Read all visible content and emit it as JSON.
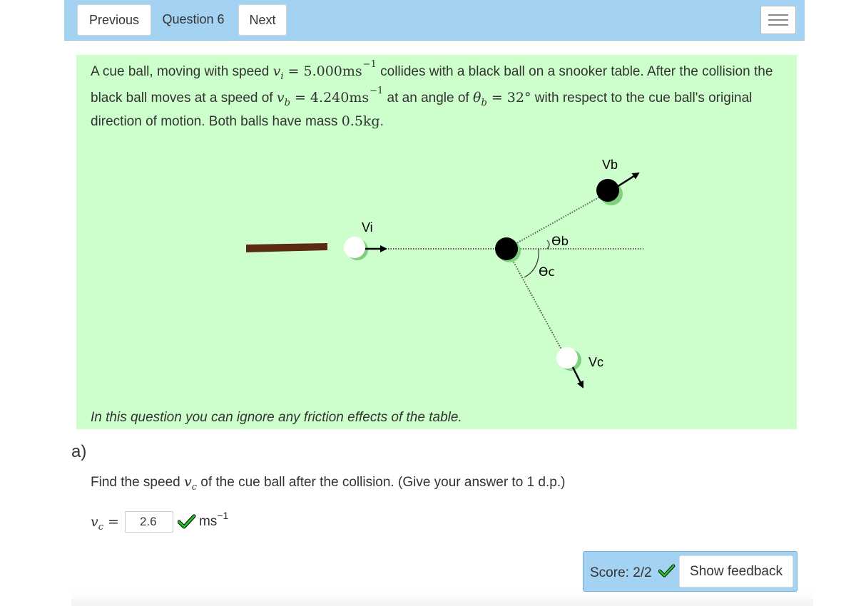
{
  "nav": {
    "previous_label": "Previous",
    "question_label": "Question 6",
    "next_label": "Next"
  },
  "statement": {
    "line1_a": "A cue ball, moving with speed ",
    "vi_symbol": "v",
    "vi_sub": "i",
    "eq1": " = 5.000ms",
    "exp1": "−1",
    "line1_b": " collides with a black ball on a snooker table. After the collision the",
    "line2_a": "black ball moves at a speed of ",
    "vb_symbol": "v",
    "vb_sub": "b",
    "eq2": " = 4.240ms",
    "exp2": "−1",
    "line2_b": " at an angle of ",
    "theta_symbol": "θ",
    "theta_sub": "b",
    "eq3": " = 32°",
    "line2_c": " with respect to the cue ball's original",
    "line3": "direction of motion. Both balls have mass ",
    "mass": "0.5kg",
    "line3_end": "."
  },
  "diagram": {
    "label_vi": "Vi",
    "label_vb": "Vb",
    "label_vc": "Vc",
    "label_theta_b": "ϴb",
    "label_theta_c": "ϴc",
    "colors": {
      "cue_stick": "#5a2a12",
      "cue_ball": "#ffffff",
      "black_ball": "#000000",
      "shadow": "#7fd07f"
    }
  },
  "friction_note": "In this question you can ignore any friction effects of the table.",
  "part": {
    "label": "a)",
    "prompt_a": "Find the speed ",
    "vc_symbol": "v",
    "vc_sub": "c",
    "prompt_b": " of the cue ball after the collision. (Give your answer to 1 d.p.)",
    "answer_lhs_symbol": "v",
    "answer_lhs_sub": "c",
    "answer_eq": " =",
    "answer_value": "2.6",
    "answer_unit": "ms",
    "answer_unit_exp": "−1",
    "answer_correct": true
  },
  "score": {
    "text": "Score: 2/2",
    "feedback_label": "Show feedback"
  }
}
